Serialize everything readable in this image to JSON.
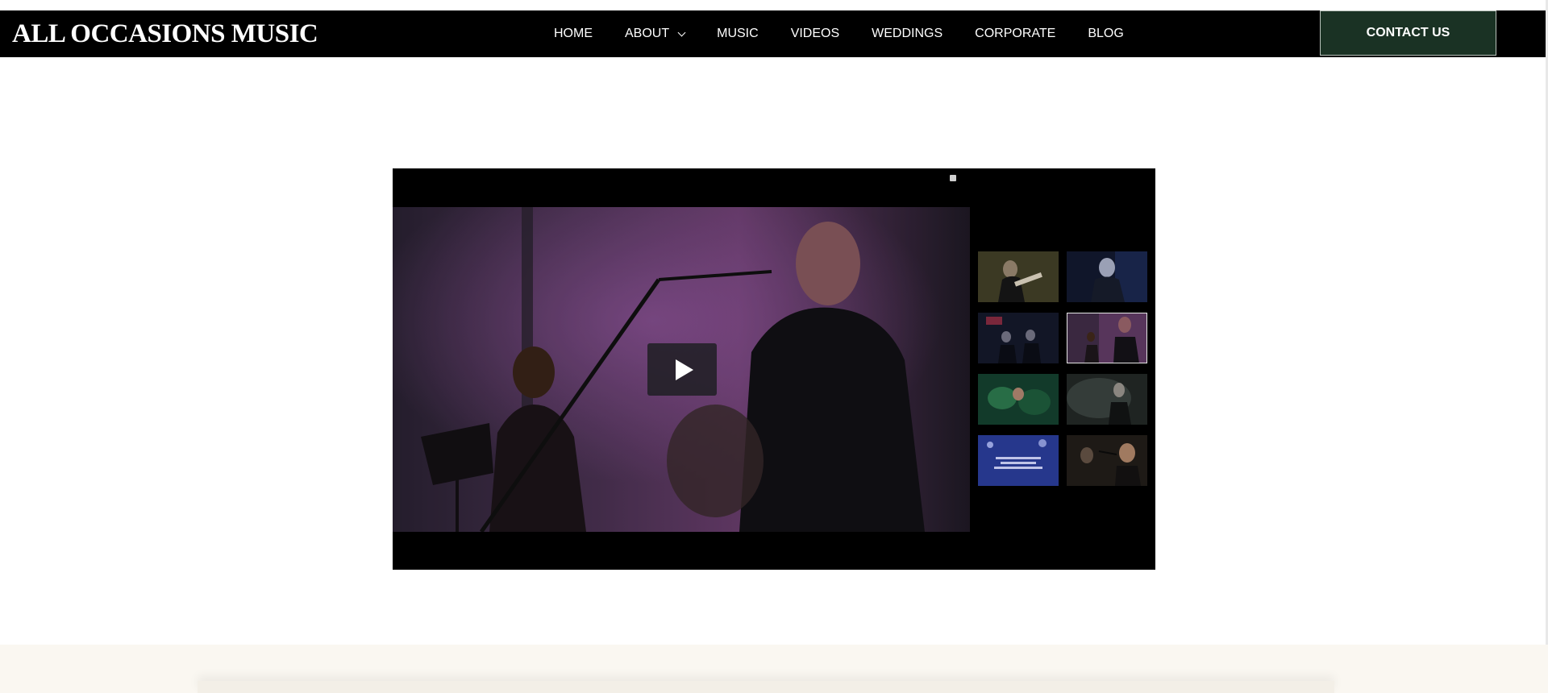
{
  "header": {
    "logo": "ALL OCCASIONS MUSIC",
    "nav": [
      {
        "label": "HOME"
      },
      {
        "label": "ABOUT",
        "dropdown": true
      },
      {
        "label": "MUSIC"
      },
      {
        "label": "VIDEOS"
      },
      {
        "label": "WEDDINGS"
      },
      {
        "label": "CORPORATE"
      },
      {
        "label": "BLOG"
      }
    ],
    "contact_label": "CONTACT US",
    "contact_color": "#1a3224"
  },
  "player": {
    "selected_index": 3,
    "play_icon": "play-icon",
    "thumbnails": [
      {
        "name": "thumbnail-guitarist-stage"
      },
      {
        "name": "thumbnail-singer-blue"
      },
      {
        "name": "thumbnail-band-wide"
      },
      {
        "name": "thumbnail-duo-purple"
      },
      {
        "name": "thumbnail-crowd-green"
      },
      {
        "name": "thumbnail-guitarist-smoke"
      },
      {
        "name": "thumbnail-text-overlay",
        "overlay_text": ""
      },
      {
        "name": "thumbnail-singer-closeup"
      }
    ]
  },
  "colors": {
    "nav_bg": "#000000",
    "accent": "#1a3224",
    "footer_bg": "#faf7f1"
  }
}
